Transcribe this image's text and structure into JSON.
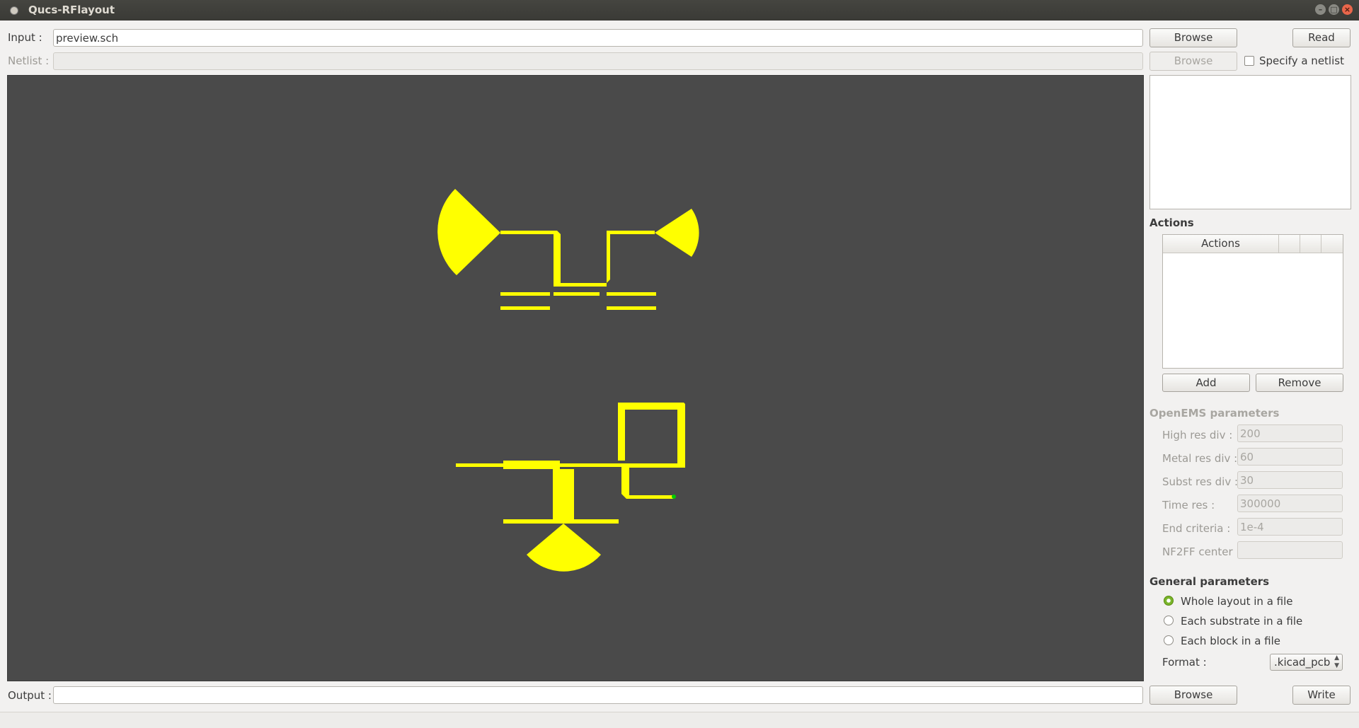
{
  "window": {
    "title": "Qucs-RFlayout"
  },
  "input": {
    "label": "Input :",
    "value": "preview.sch",
    "browse_label": "Browse",
    "read_label": "Read"
  },
  "netlist": {
    "label": "Netlist :",
    "value": "",
    "browse_label": "Browse",
    "specify_label": "Specify a netlist",
    "specify_checked": false
  },
  "actions": {
    "title": "Actions",
    "table_header": "Actions",
    "add_label": "Add",
    "remove_label": "Remove"
  },
  "openems": {
    "title": "OpenEMS parameters",
    "params": [
      {
        "label": "High res div :",
        "value": "200"
      },
      {
        "label": "Metal res div :",
        "value": "60"
      },
      {
        "label": "Subst res div :",
        "value": "30"
      },
      {
        "label": "Time res :",
        "value": "300000"
      },
      {
        "label": "End criteria :",
        "value": "1e-4"
      },
      {
        "label": "NF2FF center :",
        "value": ""
      }
    ]
  },
  "general": {
    "title": "General parameters",
    "options": [
      {
        "label": "Whole layout in a file",
        "selected": true
      },
      {
        "label": "Each substrate in a file",
        "selected": false
      },
      {
        "label": "Each block in a file",
        "selected": false
      }
    ],
    "format_label": "Format :",
    "format_value": ".kicad_pcb"
  },
  "output": {
    "label": "Output :",
    "value": "",
    "browse_label": "Browse",
    "write_label": "Write"
  },
  "colors": {
    "layout_fill": "#ffff00",
    "canvas_bg": "#4a4a4a",
    "accent": "#79b52b",
    "port_marker": "#00cc00"
  }
}
